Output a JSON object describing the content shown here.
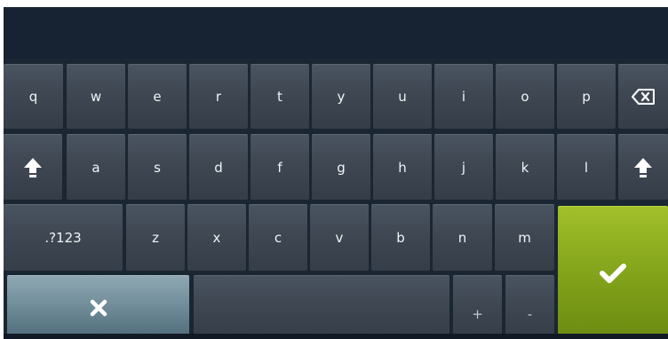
{
  "keyboard": {
    "row1": [
      "q",
      "w",
      "e",
      "r",
      "t",
      "y",
      "u",
      "i",
      "o",
      "p"
    ],
    "row2": [
      "a",
      "s",
      "d",
      "f",
      "g",
      "h",
      "j",
      "k",
      "l"
    ],
    "row3": [
      "z",
      "x",
      "c",
      "v",
      "b",
      "n",
      "m"
    ],
    "symbols_label": ".?123",
    "plus_label": "+",
    "minus_label": "-",
    "icons": {
      "backspace": "backspace-icon",
      "shift": "shift-icon",
      "accept": "checkmark-icon",
      "cancel": "close-icon"
    },
    "colors": {
      "accept": "#86a61c",
      "cancel": "#6f8b98",
      "key": "#3f4853"
    }
  }
}
